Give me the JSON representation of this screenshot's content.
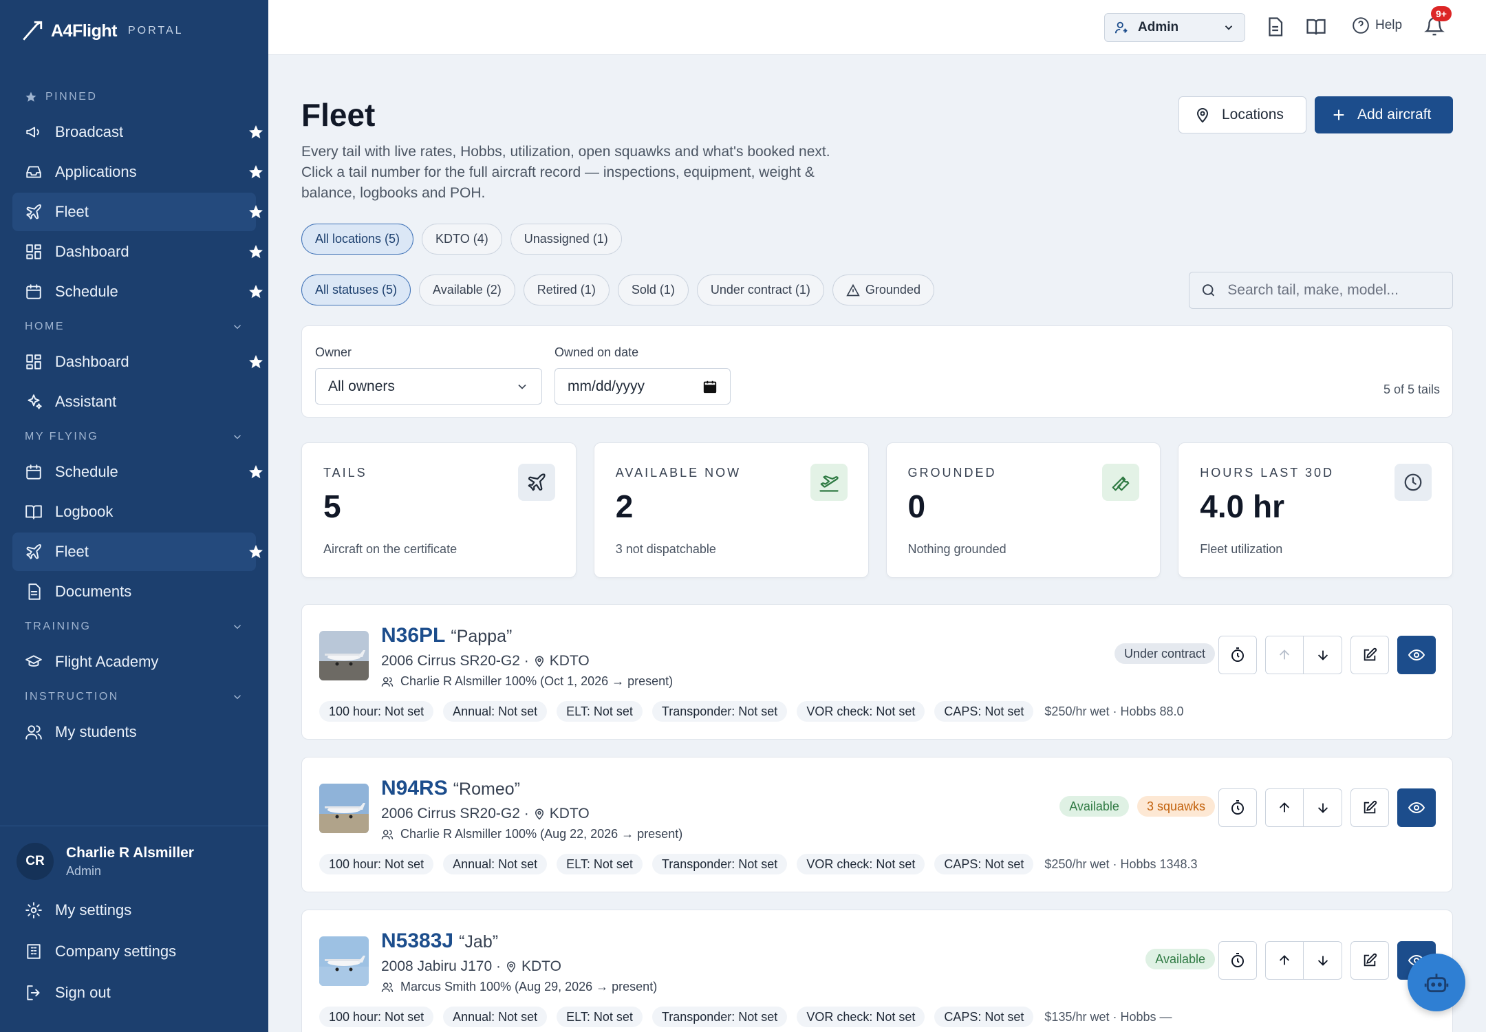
{
  "brand": {
    "name": "A4Flight",
    "portal": "PORTAL"
  },
  "sidebar": {
    "pinned_label": "PINNED",
    "pinned": [
      {
        "label": "Broadcast",
        "icon": "megaphone-icon"
      },
      {
        "label": "Applications",
        "icon": "inbox-icon"
      },
      {
        "label": "Fleet",
        "icon": "plane-icon",
        "active": true
      },
      {
        "label": "Dashboard",
        "icon": "grid-icon"
      },
      {
        "label": "Schedule",
        "icon": "calendar-icon"
      }
    ],
    "home_label": "HOME",
    "home": [
      {
        "label": "Dashboard",
        "icon": "grid-icon"
      },
      {
        "label": "Assistant",
        "icon": "sparkle-icon"
      }
    ],
    "my_flying_label": "MY FLYING",
    "my_flying": [
      {
        "label": "Schedule",
        "icon": "calendar-icon"
      },
      {
        "label": "Logbook",
        "icon": "book-icon"
      },
      {
        "label": "Fleet",
        "icon": "plane-icon",
        "active": true
      },
      {
        "label": "Documents",
        "icon": "document-icon"
      }
    ],
    "training_label": "TRAINING",
    "training": [
      {
        "label": "Flight Academy",
        "icon": "graduation-cap-icon"
      }
    ],
    "instruction_label": "INSTRUCTION",
    "instruction": [
      {
        "label": "My students",
        "icon": "users-icon"
      }
    ],
    "user": {
      "initials": "CR",
      "name": "Charlie R Alsmiller",
      "role": "Admin"
    },
    "bottom_links": [
      {
        "label": "My settings",
        "icon": "gear-icon"
      },
      {
        "label": "Company settings",
        "icon": "building-icon"
      },
      {
        "label": "Sign out",
        "icon": "sign-out-icon"
      }
    ]
  },
  "topbar": {
    "role": "Admin",
    "help": "Help",
    "notifications_badge": "9+"
  },
  "page": {
    "title": "Fleet",
    "description": "Every tail with live rates, Hobbs, utilization, open squawks and what's booked next. Click a tail number for the full aircraft record — inspections, equipment, weight & balance, logbooks and POH.",
    "locations_button": "Locations",
    "add_button": "Add aircraft",
    "location_filters": [
      "All locations (5)",
      "KDTO (4)",
      "Unassigned (1)"
    ],
    "status_filters": [
      "All statuses (5)",
      "Available (2)",
      "Retired (1)",
      "Sold (1)",
      "Under contract (1)",
      "Grounded"
    ],
    "search_placeholder": "Search tail, make, model..."
  },
  "filters": {
    "owner_label": "Owner",
    "owner_value": "All owners",
    "date_label": "Owned on date",
    "date_placeholder": "mm/dd/yyyy",
    "count": "5 of 5 tails"
  },
  "stats": [
    {
      "label": "TAILS",
      "value": "5",
      "sub": "Aircraft on the certificate",
      "icon": "plane-icon",
      "color": "#e8edf3"
    },
    {
      "label": "AVAILABLE NOW",
      "value": "2",
      "sub": "3 not dispatchable",
      "icon": "plane-takeoff-icon",
      "color": "#e3f2e6"
    },
    {
      "label": "GROUNDED",
      "value": "0",
      "sub": "Nothing grounded",
      "icon": "wrench-icon",
      "color": "#e3f2e6"
    },
    {
      "label": "HOURS LAST 30D",
      "value": "4.0 hr",
      "sub": "Fleet utilization",
      "icon": "clock-icon",
      "color": "#e8edf3"
    }
  ],
  "aircraft": [
    {
      "tail": "N36PL",
      "nick": "“Pappa”",
      "model": "2006 Cirrus SR20-G2 ·",
      "location": "KDTO",
      "owner": "Charlie R Alsmiller 100% (Oct 1, 2026 → present)",
      "badges": [
        {
          "text": "Under contract",
          "kind": "contract"
        }
      ],
      "tags": [
        "100 hour: Not set",
        "Annual: Not set",
        "ELT: Not set",
        "Transponder: Not set",
        "VOR check: Not set",
        "CAPS: Not set"
      ],
      "rate": "$250/hr wet · Hobbs 88.0"
    },
    {
      "tail": "N94RS",
      "nick": "“Romeo”",
      "model": "2006 Cirrus SR20-G2 ·",
      "location": "KDTO",
      "owner": "Charlie R Alsmiller 100% (Aug 22, 2026 → present)",
      "badges": [
        {
          "text": "Available",
          "kind": "available"
        },
        {
          "text": "3 squawks",
          "kind": "squawk"
        }
      ],
      "tags": [
        "100 hour: Not set",
        "Annual: Not set",
        "ELT: Not set",
        "Transponder: Not set",
        "VOR check: Not set",
        "CAPS: Not set"
      ],
      "rate": "$250/hr wet · Hobbs 1348.3"
    },
    {
      "tail": "N5383J",
      "nick": "“Jab”",
      "model": "2008 Jabiru J170 ·",
      "location": "KDTO",
      "owner": "Marcus Smith 100% (Aug 29, 2026 → present)",
      "badges": [
        {
          "text": "Available",
          "kind": "available"
        }
      ],
      "tags": [
        "100 hour: Not set",
        "Annual: Not set",
        "ELT: Not set",
        "Transponder: Not set",
        "VOR check: Not set",
        "CAPS: Not set"
      ],
      "rate": "$135/hr wet · Hobbs —"
    }
  ]
}
